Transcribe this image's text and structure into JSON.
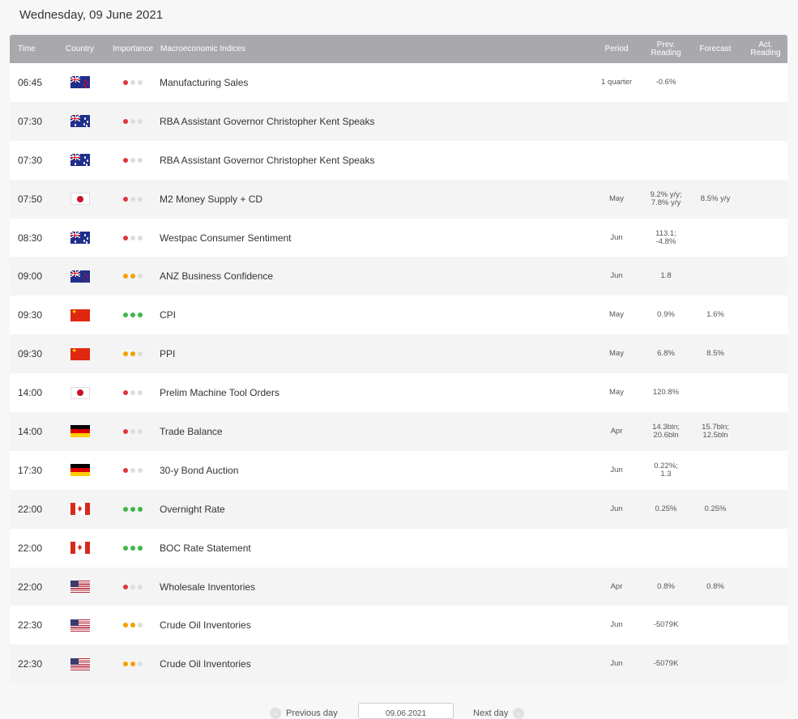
{
  "date_title": "Wednesday, 09 June 2021",
  "headers": {
    "time": "Time",
    "country": "Country",
    "importance": "Importance",
    "indices": "Macroeconomic Indices",
    "period": "Period",
    "prev_line1": "Prev.",
    "prev_line2": "Reading",
    "forecast": "Forecast",
    "act_line1": "Act.",
    "act_line2": "Reading"
  },
  "colors": {
    "low": "#e0363f",
    "medium": "#f5a000",
    "high": "#3fb54a",
    "header_bg": "#a9a9ad"
  },
  "rows": [
    {
      "time": "06:45",
      "country": "nz",
      "importance": "low",
      "name": "Manufacturing Sales",
      "period": "1 quarter",
      "prev1": "-0.6%",
      "prev2": "",
      "fore1": "",
      "fore2": ""
    },
    {
      "time": "07:30",
      "country": "au",
      "importance": "low",
      "name": "RBA Assistant Governor Christopher Kent Speaks",
      "period": "",
      "prev1": "",
      "prev2": "",
      "fore1": "",
      "fore2": ""
    },
    {
      "time": "07:30",
      "country": "au",
      "importance": "low",
      "name": "RBA Assistant Governor Christopher Kent Speaks",
      "period": "",
      "prev1": "",
      "prev2": "",
      "fore1": "",
      "fore2": ""
    },
    {
      "time": "07:50",
      "country": "jp",
      "importance": "low",
      "name": "M2 Money Supply + CD",
      "period": "May",
      "prev1": "9.2% y/y;",
      "prev2": "7.8% y/y",
      "fore1": "8.5% y/y",
      "fore2": ""
    },
    {
      "time": "08:30",
      "country": "au",
      "importance": "low",
      "name": "Westpac Consumer Sentiment",
      "period": "Jun",
      "prev1": "113.1;",
      "prev2": "-4.8%",
      "fore1": "",
      "fore2": ""
    },
    {
      "time": "09:00",
      "country": "nz",
      "importance": "medium",
      "name": "ANZ Business Confidence",
      "period": "Jun",
      "prev1": "1.8",
      "prev2": "",
      "fore1": "",
      "fore2": ""
    },
    {
      "time": "09:30",
      "country": "cn",
      "importance": "high",
      "name": "CPI",
      "period": "May",
      "prev1": "0.9%",
      "prev2": "",
      "fore1": "1.6%",
      "fore2": ""
    },
    {
      "time": "09:30",
      "country": "cn",
      "importance": "medium",
      "name": "PPI",
      "period": "May",
      "prev1": "6.8%",
      "prev2": "",
      "fore1": "8.5%",
      "fore2": ""
    },
    {
      "time": "14:00",
      "country": "jp",
      "importance": "low",
      "name": "Prelim Machine Tool Orders",
      "period": "May",
      "prev1": "120.8%",
      "prev2": "",
      "fore1": "",
      "fore2": ""
    },
    {
      "time": "14:00",
      "country": "de",
      "importance": "low",
      "name": "Trade Balance",
      "period": "Apr",
      "prev1": "14.3bln;",
      "prev2": "20.6bln",
      "fore1": "15.7bln;",
      "fore2": "12.5bln"
    },
    {
      "time": "17:30",
      "country": "de",
      "importance": "low",
      "name": "30-y Bond Auction",
      "period": "Jun",
      "prev1": "0.22%;",
      "prev2": "1.3",
      "fore1": "",
      "fore2": ""
    },
    {
      "time": "22:00",
      "country": "ca",
      "importance": "high",
      "name": "Overnight Rate",
      "period": "Jun",
      "prev1": "0.25%",
      "prev2": "",
      "fore1": "0.25%",
      "fore2": ""
    },
    {
      "time": "22:00",
      "country": "ca",
      "importance": "high",
      "name": "BOC Rate Statement",
      "period": "",
      "prev1": "",
      "prev2": "",
      "fore1": "",
      "fore2": ""
    },
    {
      "time": "22:00",
      "country": "us",
      "importance": "low",
      "name": "Wholesale Inventories",
      "period": "Apr",
      "prev1": "0.8%",
      "prev2": "",
      "fore1": "0.8%",
      "fore2": ""
    },
    {
      "time": "22:30",
      "country": "us",
      "importance": "medium",
      "name": "Crude Oil Inventories",
      "period": "Jun",
      "prev1": "-5079K",
      "prev2": "",
      "fore1": "",
      "fore2": ""
    },
    {
      "time": "22:30",
      "country": "us",
      "importance": "medium",
      "name": "Crude Oil Inventories",
      "period": "Jun",
      "prev1": "-5079K",
      "prev2": "",
      "fore1": "",
      "fore2": ""
    }
  ],
  "pager": {
    "prev_label": "Previous day",
    "date_value": "09.06.2021",
    "next_label": "Next day"
  }
}
